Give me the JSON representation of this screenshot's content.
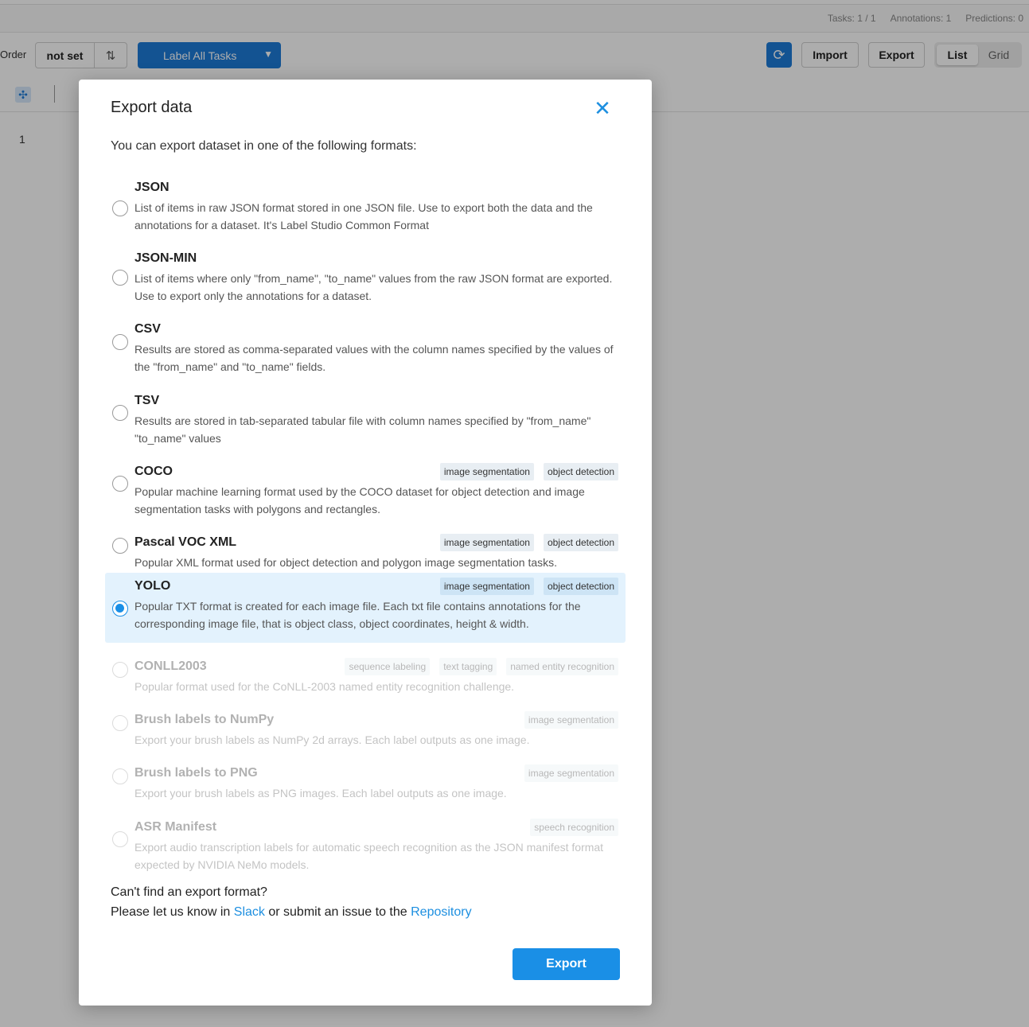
{
  "stats": {
    "tasks": "Tasks: 1 / 1",
    "annotations": "Annotations: 1",
    "predictions": "Predictions: 0"
  },
  "toolbar": {
    "order_label": "Order",
    "order_value": "not set",
    "sort_icon": "sort-icon",
    "label_all": "Label All Tasks",
    "refresh_icon": "refresh-icon",
    "import": "Import",
    "export": "Export",
    "view_list": "List",
    "view_grid": "Grid"
  },
  "table": {
    "row_number": "1"
  },
  "modal": {
    "title": "Export data",
    "close_icon": "close-icon",
    "intro": "You can export dataset in one of the following formats:",
    "formats": [
      {
        "title": "JSON",
        "desc": "List of items in raw JSON format stored in one JSON file. Use to export both the data and the annotations for a dataset. It's Label Studio Common Format",
        "tags": [],
        "state": "enabled"
      },
      {
        "title": "JSON-MIN",
        "desc": "List of items where only \"from_name\", \"to_name\" values from the raw JSON format are exported. Use to export only the annotations for a dataset.",
        "tags": [],
        "state": "enabled"
      },
      {
        "title": "CSV",
        "desc": "Results are stored as comma-separated values with the column names specified by the values of the \"from_name\" and \"to_name\" fields.",
        "tags": [],
        "state": "enabled"
      },
      {
        "title": "TSV",
        "desc": "Results are stored in tab-separated tabular file with column names specified by \"from_name\" \"to_name\" values",
        "tags": [],
        "state": "enabled"
      },
      {
        "title": "COCO",
        "desc": "Popular machine learning format used by the COCO dataset for object detection and image segmentation tasks with polygons and rectangles.",
        "tags": [
          "image segmentation",
          "object detection"
        ],
        "state": "enabled"
      },
      {
        "title": "Pascal VOC XML",
        "desc": "Popular XML format used for object detection and polygon image segmentation tasks.",
        "tags": [
          "image segmentation",
          "object detection"
        ],
        "state": "enabled"
      },
      {
        "title": "YOLO",
        "desc": "Popular TXT format is created for each image file. Each txt file contains annotations for the corresponding image file, that is object class, object coordinates, height & width.",
        "tags": [
          "image segmentation",
          "object detection"
        ],
        "state": "selected"
      },
      {
        "title": "CONLL2003",
        "desc": "Popular format used for the CoNLL-2003 named entity recognition challenge.",
        "tags": [
          "sequence labeling",
          "text tagging",
          "named entity recognition"
        ],
        "state": "disabled"
      },
      {
        "title": "Brush labels to NumPy",
        "desc": "Export your brush labels as NumPy 2d arrays. Each label outputs as one image.",
        "tags": [
          "image segmentation"
        ],
        "state": "disabled"
      },
      {
        "title": "Brush labels to PNG",
        "desc": "Export your brush labels as PNG images. Each label outputs as one image.",
        "tags": [
          "image segmentation"
        ],
        "state": "disabled"
      },
      {
        "title": "ASR Manifest",
        "desc": "Export audio transcription labels for automatic speech recognition as the JSON manifest format expected by NVIDIA NeMo models.",
        "tags": [
          "speech recognition"
        ],
        "state": "disabled"
      }
    ],
    "footer": {
      "line1": "Can't find an export format?",
      "line2_prefix": "Please let us know in",
      "slack": "Slack",
      "line2_middle": "or submit an issue to the",
      "repository": "Repository"
    },
    "export_button": "Export"
  },
  "colors": {
    "accent": "#1a8fe6",
    "selected_bg": "#e3f2fd",
    "primary_button": "#1d7bd8"
  }
}
